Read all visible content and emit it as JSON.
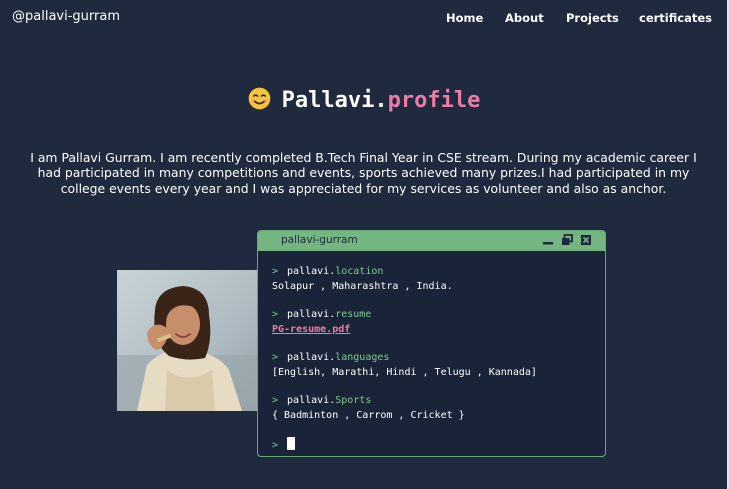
{
  "nav": {
    "brand": "@pallavi-gurram",
    "links": [
      {
        "label": "Home"
      },
      {
        "label": "About"
      },
      {
        "label": "Projects"
      },
      {
        "label": "certificates"
      }
    ]
  },
  "hero": {
    "icon": "smiling-face-emoji",
    "name": "Pallavi",
    "dot": ".",
    "accent": "profile"
  },
  "intro": {
    "text": "I am Pallavi Gurram. I am recently completed B.Tech Final Year in CSE stream. During my academic career I had participated in many competitions and events, sports achieved many prizes.I had participated in my college events every year and I was appreciated for my services as volunteer and also as anchor."
  },
  "terminal": {
    "title": "pallavi-gurram",
    "prompt": ">",
    "object": "pallavi",
    "dot": ".",
    "commands": [
      {
        "property": "location",
        "output": "Solapur , Maharashtra , India."
      },
      {
        "property": "resume",
        "output": "PG-resume.pdf"
      },
      {
        "property": "languages",
        "output": "[English, Marathi, Hindi , Telugu , Kannada]"
      },
      {
        "property": "Sports",
        "output": "{ Badminton , Carrom , Cricket }"
      }
    ]
  },
  "colors": {
    "background": "#1f2a3e",
    "accent_pink": "#ec7ba8",
    "accent_green": "#74b582"
  }
}
